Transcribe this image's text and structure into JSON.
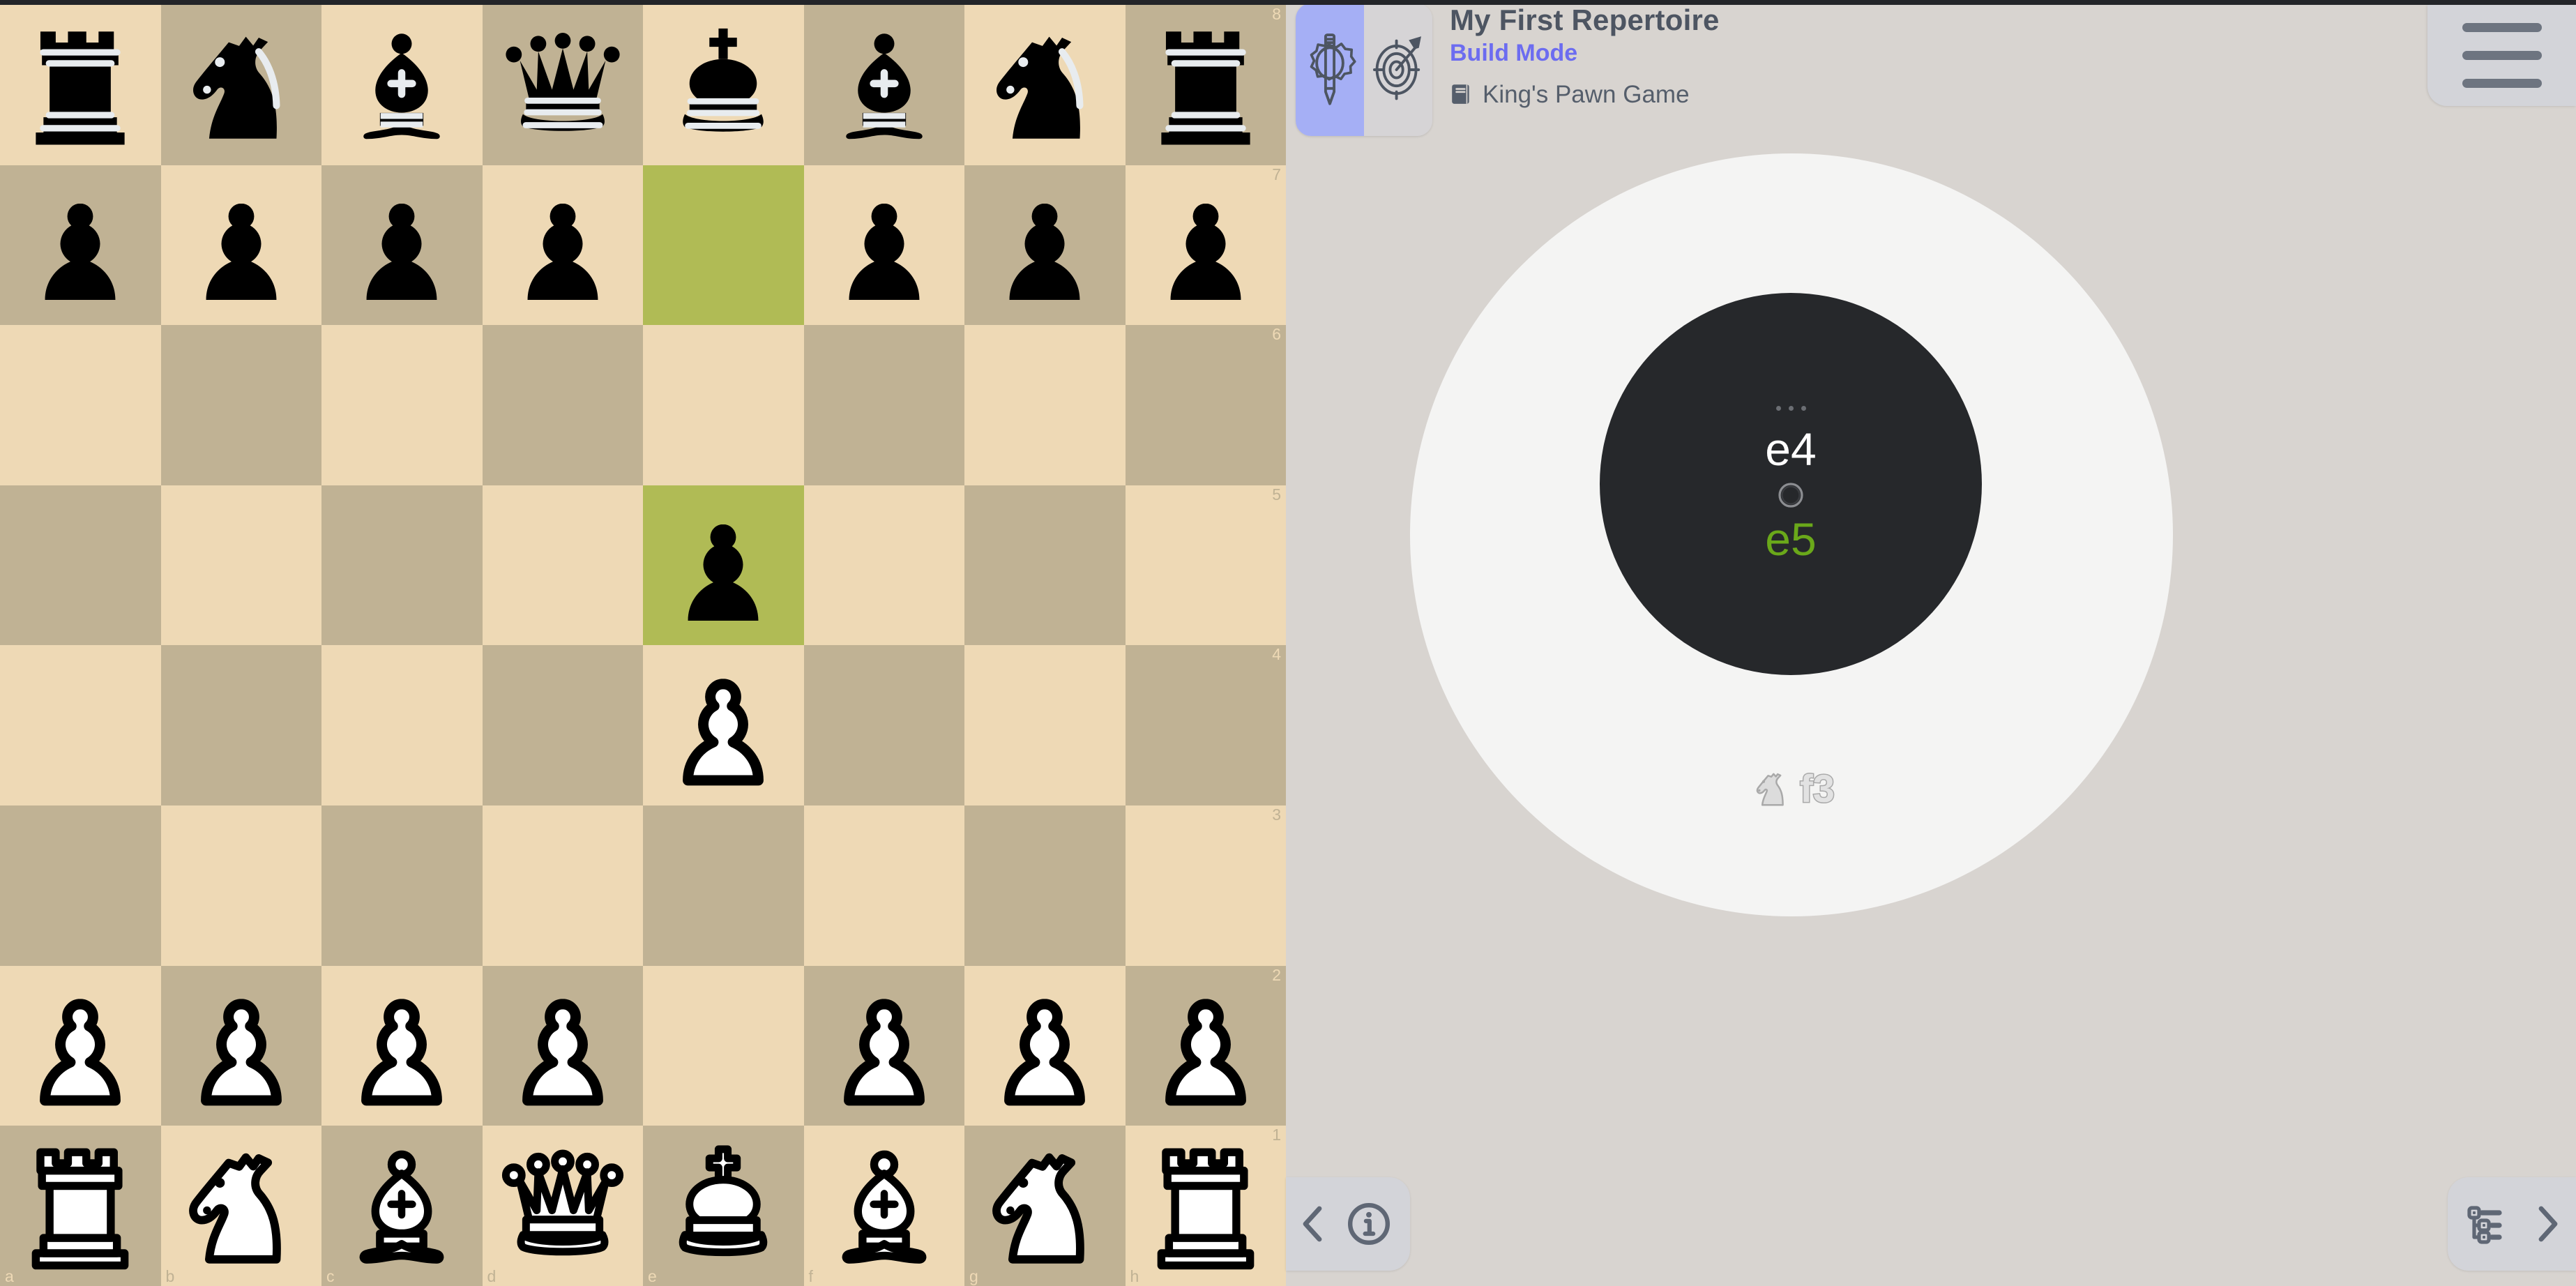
{
  "app": {
    "background_color": "#d8d4d0",
    "accent_color": "#6c6cf0",
    "highlight_color": "#b0bb55"
  },
  "header": {
    "repertoire_title": "My First Repertoire",
    "mode_label": "Build Mode",
    "opening_name": "King's Pawn Game",
    "opening_icon": "book-icon",
    "tabs": [
      {
        "name": "build-mode-tab",
        "icon": "gear-pencil-icon",
        "active": true
      },
      {
        "name": "practice-mode-tab",
        "icon": "target-arrow-icon",
        "active": false
      }
    ],
    "menu_icon": "hamburger-menu-icon"
  },
  "move_wheel": {
    "ellipsis": "...",
    "current_move_white": "e4",
    "separator_icon": "arrow-up-circle-icon",
    "current_move_black": "e5",
    "black_move_color": "#6aa81a",
    "next_move_piece_icon": "white-knight-icon",
    "next_move_label": "f3"
  },
  "bottom_bar": {
    "left": [
      {
        "name": "back-button",
        "icon": "chevron-left-icon"
      },
      {
        "name": "info-button",
        "icon": "info-circle-icon"
      }
    ],
    "right": [
      {
        "name": "tree-view-button",
        "icon": "tree-list-icon"
      },
      {
        "name": "forward-button",
        "icon": "chevron-right-icon"
      }
    ]
  },
  "board": {
    "light_square_color": "#eed9b5",
    "dark_square_color": "#c0b294",
    "orientation": "white",
    "rank_labels": [
      "8",
      "7",
      "6",
      "5",
      "4",
      "3",
      "2",
      "1"
    ],
    "file_labels": [
      "a",
      "b",
      "c",
      "d",
      "e",
      "f",
      "g",
      "h"
    ],
    "highlighted_squares": [
      "e7",
      "e5"
    ],
    "position_fen": "rnbqkbnr/pppp1ppp/8/4p3/4P3/8/PPPP1PPP/RNBQKBNR",
    "ranks": [
      {
        "rank": "8",
        "squares": [
          {
            "file": "a",
            "piece": "black-rook"
          },
          {
            "file": "b",
            "piece": "black-knight"
          },
          {
            "file": "c",
            "piece": "black-bishop"
          },
          {
            "file": "d",
            "piece": "black-queen"
          },
          {
            "file": "e",
            "piece": "black-king"
          },
          {
            "file": "f",
            "piece": "black-bishop"
          },
          {
            "file": "g",
            "piece": "black-knight"
          },
          {
            "file": "h",
            "piece": "black-rook"
          }
        ]
      },
      {
        "rank": "7",
        "squares": [
          {
            "file": "a",
            "piece": "black-pawn"
          },
          {
            "file": "b",
            "piece": "black-pawn"
          },
          {
            "file": "c",
            "piece": "black-pawn"
          },
          {
            "file": "d",
            "piece": "black-pawn"
          },
          {
            "file": "e",
            "piece": null,
            "highlight": true
          },
          {
            "file": "f",
            "piece": "black-pawn"
          },
          {
            "file": "g",
            "piece": "black-pawn"
          },
          {
            "file": "h",
            "piece": "black-pawn"
          }
        ]
      },
      {
        "rank": "6",
        "squares": [
          {
            "file": "a",
            "piece": null
          },
          {
            "file": "b",
            "piece": null
          },
          {
            "file": "c",
            "piece": null
          },
          {
            "file": "d",
            "piece": null
          },
          {
            "file": "e",
            "piece": null
          },
          {
            "file": "f",
            "piece": null
          },
          {
            "file": "g",
            "piece": null
          },
          {
            "file": "h",
            "piece": null
          }
        ]
      },
      {
        "rank": "5",
        "squares": [
          {
            "file": "a",
            "piece": null
          },
          {
            "file": "b",
            "piece": null
          },
          {
            "file": "c",
            "piece": null
          },
          {
            "file": "d",
            "piece": null
          },
          {
            "file": "e",
            "piece": "black-pawn",
            "highlight": true
          },
          {
            "file": "f",
            "piece": null
          },
          {
            "file": "g",
            "piece": null
          },
          {
            "file": "h",
            "piece": null
          }
        ]
      },
      {
        "rank": "4",
        "squares": [
          {
            "file": "a",
            "piece": null
          },
          {
            "file": "b",
            "piece": null
          },
          {
            "file": "c",
            "piece": null
          },
          {
            "file": "d",
            "piece": null
          },
          {
            "file": "e",
            "piece": "white-pawn"
          },
          {
            "file": "f",
            "piece": null
          },
          {
            "file": "g",
            "piece": null
          },
          {
            "file": "h",
            "piece": null
          }
        ]
      },
      {
        "rank": "3",
        "squares": [
          {
            "file": "a",
            "piece": null
          },
          {
            "file": "b",
            "piece": null
          },
          {
            "file": "c",
            "piece": null
          },
          {
            "file": "d",
            "piece": null
          },
          {
            "file": "e",
            "piece": null
          },
          {
            "file": "f",
            "piece": null
          },
          {
            "file": "g",
            "piece": null
          },
          {
            "file": "h",
            "piece": null
          }
        ]
      },
      {
        "rank": "2",
        "squares": [
          {
            "file": "a",
            "piece": "white-pawn"
          },
          {
            "file": "b",
            "piece": "white-pawn"
          },
          {
            "file": "c",
            "piece": "white-pawn"
          },
          {
            "file": "d",
            "piece": "white-pawn"
          },
          {
            "file": "e",
            "piece": null
          },
          {
            "file": "f",
            "piece": "white-pawn"
          },
          {
            "file": "g",
            "piece": "white-pawn"
          },
          {
            "file": "h",
            "piece": "white-pawn"
          }
        ]
      },
      {
        "rank": "1",
        "squares": [
          {
            "file": "a",
            "piece": "white-rook"
          },
          {
            "file": "b",
            "piece": "white-knight"
          },
          {
            "file": "c",
            "piece": "white-bishop"
          },
          {
            "file": "d",
            "piece": "white-queen"
          },
          {
            "file": "e",
            "piece": "white-king"
          },
          {
            "file": "f",
            "piece": "white-bishop"
          },
          {
            "file": "g",
            "piece": "white-knight"
          },
          {
            "file": "h",
            "piece": "white-rook"
          }
        ]
      }
    ]
  }
}
